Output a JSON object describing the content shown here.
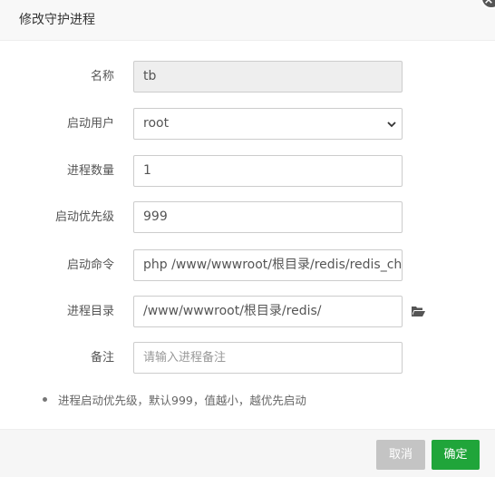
{
  "dialog": {
    "title": "修改守护进程",
    "close_glyph": "×"
  },
  "form": {
    "name": {
      "label": "名称",
      "value": "tb"
    },
    "user": {
      "label": "启动用户",
      "value": "root"
    },
    "count": {
      "label": "进程数量",
      "value": "1"
    },
    "priority": {
      "label": "启动优先级",
      "value": "999"
    },
    "command": {
      "label": "启动命令",
      "value": "php /www/wwwroot/根目录/redis/redis_chu.php"
    },
    "directory": {
      "label": "进程目录",
      "value": "/www/wwwroot/根目录/redis/"
    },
    "remark": {
      "label": "备注",
      "value": "",
      "placeholder": "请输入进程备注"
    }
  },
  "tips": {
    "text": "进程启动优先级，默认999，值越小，越优先启动"
  },
  "footer": {
    "cancel_label": "取消",
    "ok_label": "确定"
  },
  "colors": {
    "primary": "#20a53a",
    "cancel": "#c4c4c4"
  }
}
